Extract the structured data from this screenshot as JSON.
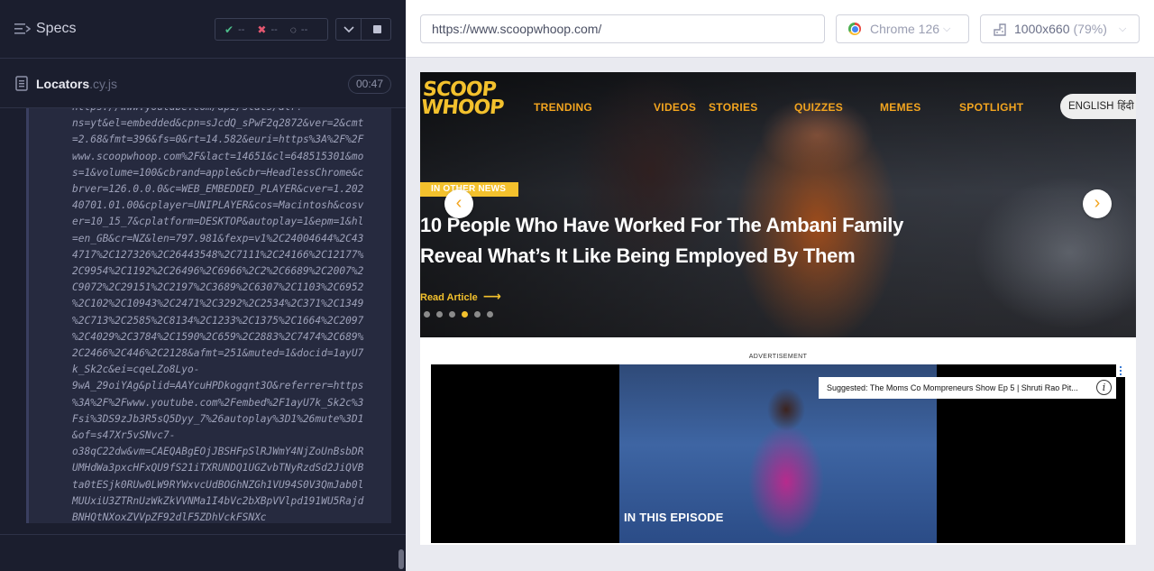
{
  "reporter": {
    "specs_title": "Specs",
    "stats": {
      "passed": "--",
      "failed": "--",
      "pending": "--"
    },
    "file": {
      "name": "Locators",
      "ext": ".cy.js",
      "duration": "00:47"
    },
    "log_lines": [
      "https://www.youtube.com/api/stats/atr?",
      "ns=yt&el=embedded&cpn=sJcdQ_sPwF2q2872&ver=2&cmt",
      "=2.68&fmt=396&fs=0&rt=14.582&euri=https%3A%2F%2F",
      "www.scoopwhoop.com%2F&lact=14651&cl=648515301&mo",
      "s=1&volume=100&cbrand=apple&cbr=HeadlessChrome&c",
      "brver=126.0.0.0&c=WEB_EMBEDDED_PLAYER&cver=1.202",
      "40701.01.00&cplayer=UNIPLAYER&cos=Macintosh&cosv",
      "er=10_15_7&cplatform=DESKTOP&autoplay=1&epm=1&hl",
      "=en_GB&cr=NZ&len=797.981&fexp=v1%2C24004644%2C43",
      "4717%2C127326%2C26443548%2C7111%2C24166%2C12177%",
      "2C9954%2C1192%2C26496%2C6966%2C2%2C6689%2C2007%2",
      "C9072%2C29151%2C2197%2C3689%2C6307%2C1103%2C6952",
      "%2C102%2C10943%2C2471%2C3292%2C2534%2C371%2C1349",
      "%2C713%2C2585%2C8134%2C1233%2C1375%2C1664%2C2097",
      "%2C4029%2C3784%2C1590%2C659%2C2883%2C7474%2C689%",
      "2C2466%2C446%2C2128&afmt=251&muted=1&docid=1ayU7",
      "k_Sk2c&ei=cqeLZo8Lyo-",
      "9wA_29oiYAg&plid=AAYcuHPDkogqnt3O&referrer=https",
      "%3A%2F%2Fwww.youtube.com%2Fembed%2F1ayU7k_Sk2c%3",
      "Fsi%3DS9zJb3R5sQ5Dyy_7%26autoplay%3D1%26mute%3D1",
      "&of=s47Xr5vSNvc7-",
      "o38qC22dw&vm=CAEQABgEOjJBSHFpSlRJWmY4NjZoUnBsbDR",
      "UMHdWa3pxcHFxQU9fS21iTXRUNDQ1UGZvbTNyRzdSd2JiQVB",
      "ta0tESjk0RUw0LW9RYWxvcUdBOGhNZGh1VU94S0V3QmJab0l",
      "MUUxiU3ZTRnUzWkZkVVNMa1I4bVc2bXBpVVlpd191WU5Rajd",
      "BNHQtNXoxZVVpZF92dlF5ZDhVckFSNXc"
    ]
  },
  "browser": {
    "url": "https://www.scoopwhoop.com/",
    "browser_name": "Chrome 126",
    "viewport": "1000x660",
    "scale": "(79%)"
  },
  "site": {
    "logo": "SCOOP WHOOP",
    "nav": [
      "TRENDING",
      "VIDEOS",
      "STORIES",
      "QUIZZES",
      "MEMES",
      "SPOTLIGHT"
    ],
    "lang": {
      "primary": "ENGLISH",
      "alt": "हिंदी"
    },
    "hero": {
      "tag": "IN OTHER NEWS",
      "headline_line1": "10 People Who Have Worked For The Ambani Family",
      "headline_line2": "Reveal What’s It Like Being Employed By Them",
      "read_more": "Read Article",
      "active_dot": 4,
      "dot_count": 6
    },
    "ad": {
      "label": "ADVERTISEMENT",
      "suggested": "Suggested: The Moms Co Mompreneurs Show Ep 5 | Shruti Rao Pit...",
      "episode_text": "IN THIS EPISODE"
    }
  },
  "colors": {
    "reporter_bg": "#1b1e2e",
    "accent_yellow": "#f3c12d",
    "nav_orange": "#f3a51f",
    "pass_green": "#4dbd8a",
    "fail_red": "#e45770"
  },
  "icons": [
    "list-icon",
    "check-icon",
    "x-icon",
    "spinner-icon",
    "chevron-down-icon",
    "stop-icon",
    "file-icon",
    "chrome-icon",
    "ruler-icon",
    "arrow-left-icon",
    "arrow-right-icon",
    "info-icon"
  ]
}
